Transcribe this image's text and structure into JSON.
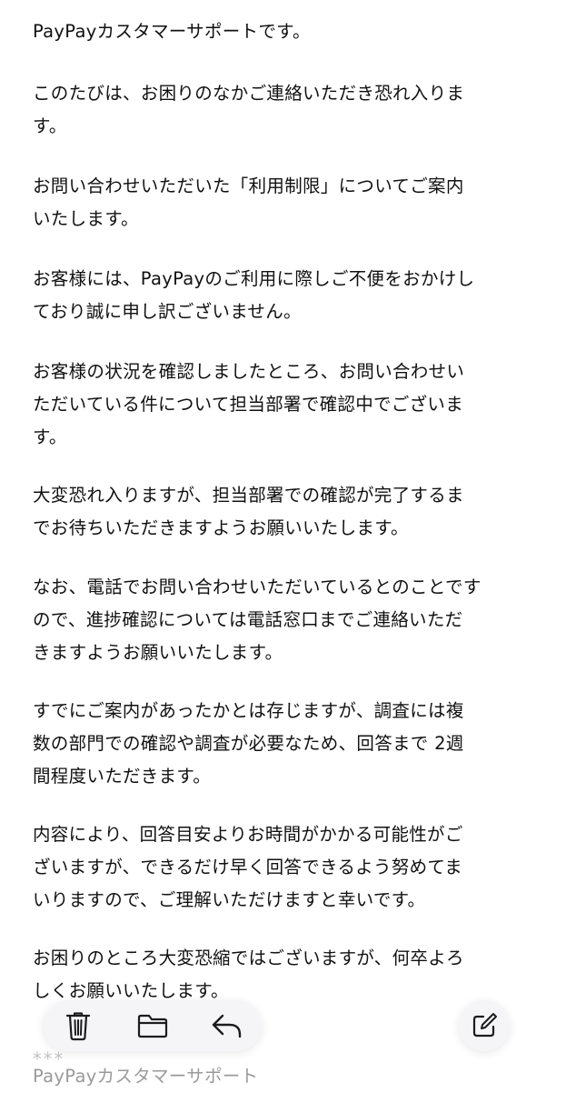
{
  "email": {
    "paragraphs": [
      [
        "PayPayカスタマーサポートです。"
      ],
      [
        "このたびは、お困りのなかご連絡いただき恐れ入りま",
        "す。"
      ],
      [
        "お問い合わせいただいた「利用制限」についてご案内",
        "いたします。"
      ],
      [
        "お客様には、PayPayのご利用に際しご不便をおかけし",
        "ており誠に申し訳ございません。"
      ],
      [
        "お客様の状況を確認しましたところ、お問い合わせい",
        "ただいている件について担当部署で確認中でございま",
        "す。"
      ],
      [
        "大変恐れ入りますが、担当部署での確認が完了するま",
        "でお待ちいただきますようお願いいたします。"
      ],
      [
        "なお、電話でお問い合わせいただいているとのことです",
        "ので、進捗確認については電話窓口までご連絡いただ",
        "きますようお願いいたします。"
      ],
      [
        "すでにご案内があったかとは存じますが、調査には複",
        "数の部門での確認や調査が必要なため、回答まで 2週",
        "間程度いただきます。"
      ],
      [
        "内容により、回答目安よりお時間がかかる可能性がご",
        "ざいますが、できるだけ早く回答できるよう努めてま",
        "いりますので、ご理解いただけますと幸いです。"
      ],
      [
        "お困りのところ大変恐縮ではございますが、何卒よろ",
        "しくお願いいたします。"
      ]
    ],
    "signature_separator": "***",
    "signature_name": "PayPayカスタマーサポート"
  },
  "toolbar": {
    "icons": [
      "trash-icon",
      "folder-icon",
      "reply-icon"
    ],
    "compose_icon": "compose-icon",
    "icon_color": "#1c1c1e"
  }
}
